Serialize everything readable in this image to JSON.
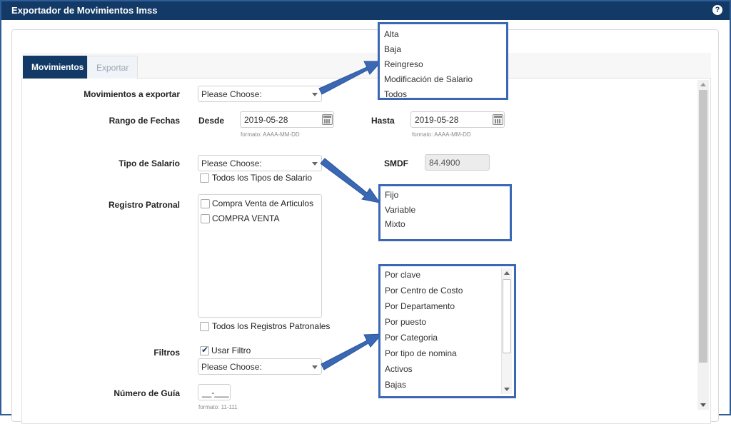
{
  "window": {
    "title": "Exportador de Movimientos Imss",
    "help_icon": "?"
  },
  "tabs": [
    {
      "label": "Movimientos",
      "active": true
    },
    {
      "label": "Exportar",
      "active": false
    }
  ],
  "form": {
    "movimientos": {
      "label": "Movimientos a exportar",
      "value": "Please Choose:"
    },
    "rango": {
      "label": "Rango de Fechas",
      "desde_label": "Desde",
      "desde_value": "2019-05-28",
      "desde_hint": "formato: AAAA-MM-DD",
      "hasta_label": "Hasta",
      "hasta_value": "2019-05-28",
      "hasta_hint": "formato: AAAA-MM-DD"
    },
    "tipo_salario": {
      "label": "Tipo de Salario",
      "value": "Please Choose:",
      "todos_label": "Todos los Tipos de Salario"
    },
    "smdf": {
      "label": "SMDF",
      "value": "84.4900"
    },
    "registro": {
      "label": "Registro Patronal",
      "items": [
        "Compra Venta de Articulos",
        "COMPRA VENTA"
      ],
      "todos_label": "Todos los Registros Patronales"
    },
    "filtros": {
      "label": "Filtros",
      "usar_filtro_label": "Usar Filtro",
      "usar_filtro_checked": true,
      "value": "Please Choose:"
    },
    "numero_guia": {
      "label": "Número de Guía",
      "value": "__-___",
      "hint": "formato: 11-111"
    }
  },
  "callouts": {
    "movimientos_options": [
      "Alta",
      "Baja",
      "Reingreso",
      "Modificación de Salario",
      "Todos"
    ],
    "salario_options": [
      "Fijo",
      "Variable",
      "Mixto"
    ],
    "filtro_options": [
      "Por clave",
      "Por Centro de Costo",
      "Por Departamento",
      "Por puesto",
      "Por Categoria",
      "Por tipo de nomina",
      "Activos",
      "Bajas"
    ]
  },
  "colors": {
    "titlebar": "#133a66",
    "accent": "#3a68b4",
    "active_tab": "#133a66"
  }
}
